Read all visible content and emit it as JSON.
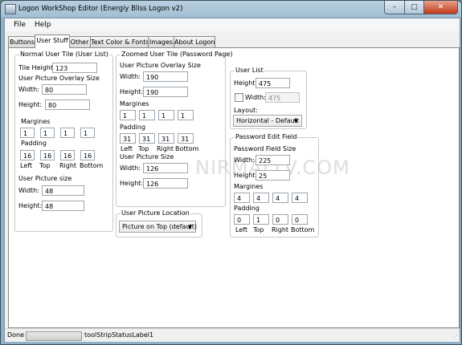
{
  "window": {
    "title": "Logon WorkShop Editor (Energiy Bliss Logon v2)",
    "min": "–",
    "max": "□",
    "close": "✕"
  },
  "menu": {
    "file": "File",
    "help": "Help"
  },
  "tabs": [
    "Buttons",
    "User Stuff",
    "Other",
    "Text Color & Fonts",
    "Images",
    "About Logon"
  ],
  "active_tab": "User Stuff",
  "normal_tile": {
    "title": "Normal User Tile (User List)",
    "tile_height_label": "Tile Height:",
    "tile_height": "123",
    "overlay_title": "User Picture Overlay Size",
    "width_label": "Width:",
    "overlay_width": "80",
    "height_label": "Height:",
    "overlay_height": "80",
    "margins_label": "Margines",
    "margins": [
      "1",
      "1",
      "1",
      "1"
    ],
    "padding_label": "Padding",
    "padding": [
      "16",
      "16",
      "16",
      "16"
    ],
    "left_label": "Left",
    "top_label": "Top",
    "right_label": "Right",
    "bottom_label": "Bottom",
    "picsize_title": "User Picture size",
    "pic_width": "48",
    "pic_height": "48"
  },
  "zoomed_tile": {
    "title": "Zoomed User Tile (Password Page)",
    "overlay_title": "User Picture Overlay Size",
    "width_label": "Width:",
    "overlay_width": "190",
    "height_label": "Height:",
    "overlay_height": "190",
    "margins_label": "Margines",
    "margins": [
      "1",
      "1",
      "1",
      "1"
    ],
    "padding_label": "Padding",
    "padding": [
      "31",
      "31",
      "31",
      "31"
    ],
    "left_label": "Left",
    "top_label": "Top",
    "right_label": "Right",
    "bottom_label": "Bottom",
    "picsize_title": "User Picture Size",
    "pic_width": "126",
    "pic_height": "126"
  },
  "picture_location": {
    "title": "User Picture Location",
    "value": "Picture on Top (default)"
  },
  "user_list": {
    "title": "User List",
    "height_label": "Height:",
    "height": "475",
    "width_label": "Width:",
    "width": "475",
    "layout_label": "Layout:",
    "layout": "Horizontal - Default"
  },
  "password_field": {
    "title": "Password Edit Field",
    "size_title": "Password Field Size",
    "width_label": "Width:",
    "width": "225",
    "height_label": "Height:",
    "height": "25",
    "margins_label": "Margines",
    "margins": [
      "4",
      "4",
      "4",
      "4"
    ],
    "padding_label": "Padding",
    "padding": [
      "0",
      "1",
      "0",
      "0"
    ],
    "left_label": "Left",
    "top_label": "Top",
    "right_label": "Right",
    "bottom_label": "Bottom"
  },
  "watermark": {
    "main": "NIRMALTV.COM"
  },
  "status": {
    "text": "Done",
    "label": "toolStripStatusLabel1"
  }
}
